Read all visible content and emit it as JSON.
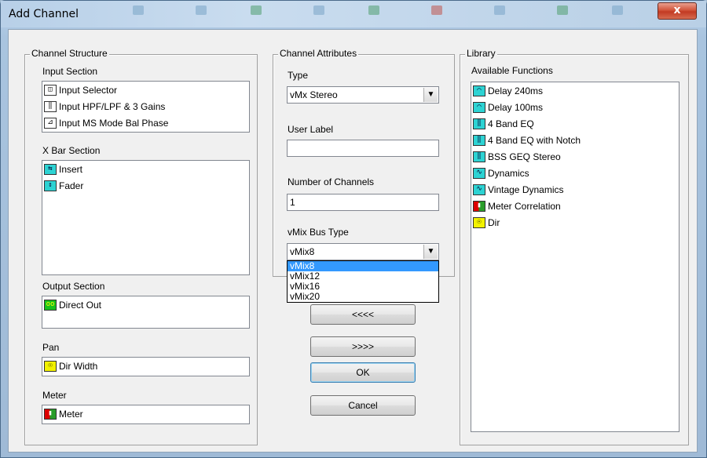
{
  "window": {
    "title": "Add Channel",
    "close_glyph": "x"
  },
  "structure": {
    "legend": "Channel Structure",
    "input_section": {
      "label": "Input Section",
      "items": [
        {
          "label": "Input Selector",
          "icon": "input-selector-icon"
        },
        {
          "label": "Input HPF/LPF & 3 Gains",
          "icon": "eq-icon"
        },
        {
          "label": "Input MS Mode Bal Phase",
          "icon": "ms-mode-icon"
        }
      ]
    },
    "xbar_section": {
      "label": "X Bar Section",
      "items": [
        {
          "label": "Insert",
          "icon": "insert-icon"
        },
        {
          "label": "Fader",
          "icon": "fader-icon"
        }
      ]
    },
    "output_section": {
      "label": "Output Section",
      "items": [
        {
          "label": "Direct Out",
          "icon": "direct-out-icon"
        }
      ]
    },
    "pan": {
      "label": "Pan",
      "items": [
        {
          "label": "Dir Width",
          "icon": "pan-icon"
        }
      ]
    },
    "meter": {
      "label": "Meter",
      "items": [
        {
          "label": "Meter",
          "icon": "meter-icon"
        }
      ]
    }
  },
  "attributes": {
    "legend": "Channel Attributes",
    "type_label": "Type",
    "type_value": "vMx Stereo",
    "user_label_label": "User Label",
    "user_label_value": "",
    "num_channels_label": "Number of Channels",
    "num_channels_value": "1",
    "bus_type_label": "vMix Bus Type",
    "bus_type_value": "vMix8",
    "bus_type_options": [
      "vMix8",
      "vMix12",
      "vMix16",
      "vMix20"
    ]
  },
  "buttons": {
    "remove": "<<<<",
    "add": ">>>>",
    "ok": "OK",
    "cancel": "Cancel"
  },
  "library": {
    "legend": "Library",
    "available_label": "Available Functions",
    "items": [
      {
        "label": "Delay 240ms",
        "icon": "delay-icon"
      },
      {
        "label": "Delay 100ms",
        "icon": "delay-icon"
      },
      {
        "label": "4 Band EQ",
        "icon": "eq-icon"
      },
      {
        "label": "4 Band EQ with Notch",
        "icon": "eq-icon"
      },
      {
        "label": "BSS GEQ Stereo",
        "icon": "eq-icon"
      },
      {
        "label": "Dynamics",
        "icon": "dynamics-icon"
      },
      {
        "label": "Vintage Dynamics",
        "icon": "dynamics-icon"
      },
      {
        "label": "Meter Correlation",
        "icon": "meter-icon"
      },
      {
        "label": "Dir",
        "icon": "pan-icon"
      }
    ]
  },
  "colors": {
    "accent_selection": "#3399ff",
    "close_button": "#c23a22",
    "cyan_icon": "#2dd3d3",
    "green_icon": "#17c21b",
    "yellow_icon": "#f2f200"
  }
}
